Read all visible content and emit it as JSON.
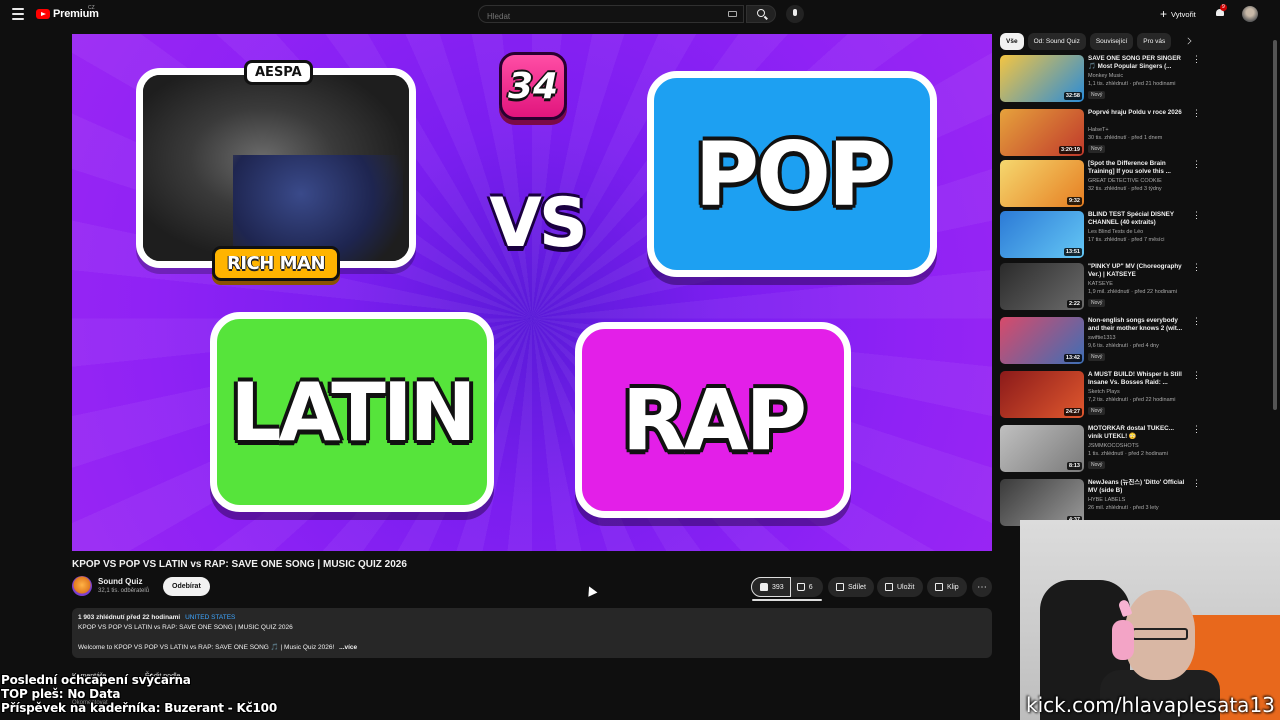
{
  "header": {
    "logo_text": "Premium",
    "logo_country": "CZ",
    "search_placeholder": "Hledat",
    "create_label": "Vytvořit",
    "notif_count": "9"
  },
  "video": {
    "counter": "34",
    "tag_artist": "AESPA",
    "tag_song": "RICH MAN",
    "vs": "VS",
    "genre_1": "POP",
    "genre_2": "LATIN",
    "genre_3": "RAP",
    "title": "KPOP VS POP VS LATIN vs RAP: SAVE ONE SONG | MUSIC QUIZ 2026"
  },
  "channel": {
    "name": "Sound Quiz",
    "subs": "32,1 tis. odběratelů",
    "subscribe_label": "Odebírat"
  },
  "actions": {
    "likes": "393",
    "dislikes": "6",
    "share": "Sdílet",
    "save": "Uložit",
    "clip": "Klip",
    "more": "⋯"
  },
  "description": {
    "views": "1 903 zhlédnutí",
    "age": "před 22 hodinami",
    "location": "UNITED STATES",
    "line1": "KPOP VS POP VS LATIN vs RAP: SAVE ONE SONG | MUSIC QUIZ 2026",
    "line2": "Welcome to KPOP VS POP VS LATIN vs RAP: SAVE ONE SONG 🎵 | Music Quiz 2026!",
    "more": "...více"
  },
  "comments": {
    "label": "Komentáře",
    "sort": "Řadit podle",
    "prompt": "Okomentovat"
  },
  "chips": [
    "Vše",
    "Od: Sound Quiz",
    "Související",
    "Pro vás"
  ],
  "sidebar": [
    {
      "title": "SAVE ONE SONG PER SINGER 🎵 Most Popular Singers (...",
      "channel": "Monkey Music",
      "stats": "1,1 tis. zhlédnutí · před 21 hodinami",
      "new": "Nový",
      "dur": "32:58",
      "colors": [
        "#f4c542",
        "#2a8cd8"
      ]
    },
    {
      "title": "Poprvé hraju Poldu v roce 2026",
      "channel": "HalseT+",
      "stats": "30 tis. zhlédnutí · před 1 dnem",
      "new": "Nový",
      "dur": "3:20:19",
      "colors": [
        "#e6a23c",
        "#c0392b"
      ]
    },
    {
      "title": "[Spot the Difference Brain Training] If you solve this ...",
      "channel": "GREAT DETECTIVE COOKIE",
      "stats": "32 tis. zhlédnutí · před 3 týdny",
      "new": "",
      "dur": "9:32",
      "colors": [
        "#f5d76e",
        "#e67e22"
      ]
    },
    {
      "title": "BLIND TEST Spécial DISNEY CHANNEL (40 extraits)",
      "channel": "Les Blind Tests de Léo",
      "stats": "17 tis. zhlédnutí · před 7 měsíci",
      "new": "",
      "dur": "13:51",
      "colors": [
        "#2c7ad6",
        "#64c7f5"
      ]
    },
    {
      "title": "\"PINKY UP\" MV (Choreography Ver.) | KATSEYE",
      "channel": "KATSEYE",
      "stats": "1,9 mil. zhlédnutí · před 22 hodinami",
      "new": "Nový",
      "dur": "2:22",
      "colors": [
        "#2b2b2b",
        "#6b6b6b"
      ]
    },
    {
      "title": "Non-english songs everybody and their mother knows 2 (wit...",
      "channel": "swiftie1313",
      "stats": "9,6 tis. zhlédnutí · před 4 dny",
      "new": "Nový",
      "dur": "13:42",
      "colors": [
        "#d84a6a",
        "#3d6fb6"
      ]
    },
    {
      "title": "A MUST BUILD! Whisper Is Still Insane Vs. Bosses Raid: ...",
      "channel": "Sketch Plays",
      "stats": "7,2 tis. zhlédnutí · před 22 hodinami",
      "new": "Nový",
      "dur": "24:27",
      "colors": [
        "#8b1a1a",
        "#e0582e"
      ]
    },
    {
      "title": "MOTORKÁŘ dostal ŤUKEC... viník UTEKL! 😳",
      "channel": "JSMMKOCOSHOTS",
      "stats": "1 tis. zhlédnutí · před 2 hodinami",
      "new": "Nový",
      "dur": "8:13",
      "colors": [
        "#c0c0c0",
        "#7a7a7a"
      ]
    },
    {
      "title": "NewJeans (뉴진스) 'Ditto' Official MV (side B)",
      "channel": "HYBE LABELS",
      "stats": "26 mil. zhlédnutí · před 3 lety",
      "new": "",
      "dur": "4:37",
      "colors": [
        "#3a3a3a",
        "#9a9a9a"
      ]
    }
  ],
  "overlay": {
    "line1": "Poslední ochcapení svýcarna",
    "line2": "TOP pleš: No Data",
    "line3": "Příspěvek na kadeřníka: Buzerant - Kč100",
    "kick": "kick.com/hlavaplesata13"
  }
}
